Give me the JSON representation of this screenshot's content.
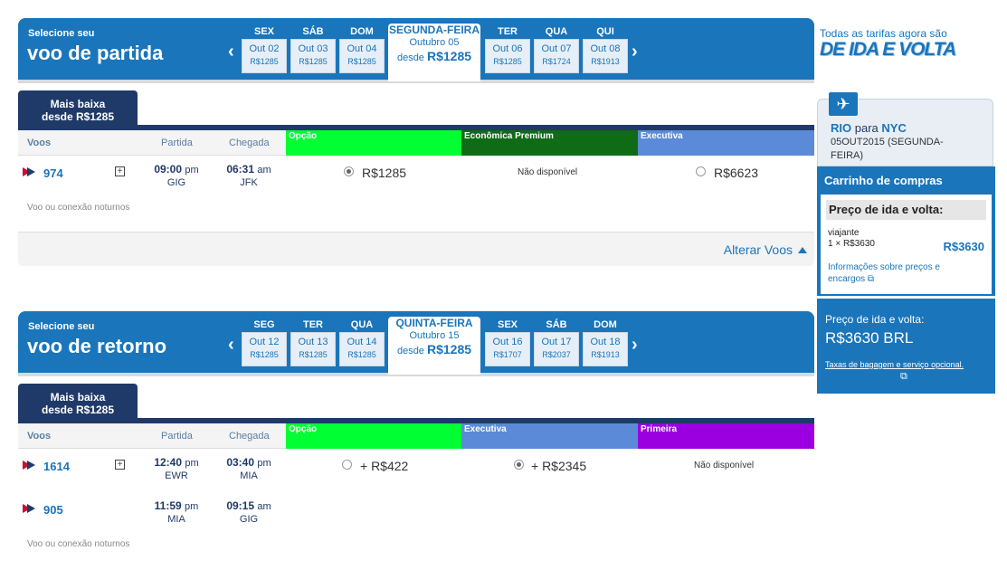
{
  "outbound": {
    "select_small": "Selecione seu",
    "select_big": "voo de partida",
    "days": [
      {
        "name": "SEX",
        "date": "Out 02",
        "price": "R$1285"
      },
      {
        "name": "SÁB",
        "date": "Out 03",
        "price": "R$1285"
      },
      {
        "name": "DOM",
        "date": "Out 04",
        "price": "R$1285"
      },
      {
        "name": "TER",
        "date": "Out 06",
        "price": "R$1285"
      },
      {
        "name": "QUA",
        "date": "Out 07",
        "price": "R$1724"
      },
      {
        "name": "QUI",
        "date": "Out 08",
        "price": "R$1913"
      }
    ],
    "selected": {
      "name": "SEGUNDA-FEIRA",
      "month": "Outubro 05",
      "from": "desde",
      "price": "R$1285"
    },
    "tab": {
      "line1": "Mais baixa",
      "line2": "desde R$1285"
    },
    "headers": {
      "voos": "Voos",
      "partida": "Partida",
      "chegada": "Chegada",
      "fare1": "Opção",
      "fare2": "Econômica Premium",
      "fare3": "Executiva"
    },
    "rows": [
      {
        "flight": "974",
        "dep_time": "09:00",
        "dep_ampm": "pm",
        "dep_airport": "GIG",
        "arr_time": "06:31",
        "arr_ampm": "am",
        "arr_airport": "JFK",
        "fare1": "R$1285",
        "fare2": "Não disponível",
        "fare3": "R$6623"
      }
    ],
    "night_note": "Voo ou conexão noturnos",
    "change_label": "Alterar Voos"
  },
  "return": {
    "select_small": "Selecione seu",
    "select_big": "voo de retorno",
    "days": [
      {
        "name": "SEG",
        "date": "Out 12",
        "price": "R$1285"
      },
      {
        "name": "TER",
        "date": "Out 13",
        "price": "R$1285"
      },
      {
        "name": "QUA",
        "date": "Out 14",
        "price": "R$1285"
      },
      {
        "name": "SEX",
        "date": "Out 16",
        "price": "R$1707"
      },
      {
        "name": "SÁB",
        "date": "Out 17",
        "price": "R$2037"
      },
      {
        "name": "DOM",
        "date": "Out 18",
        "price": "R$1913"
      }
    ],
    "selected": {
      "name": "QUINTA-FEIRA",
      "month": "Outubro 15",
      "from": "desde",
      "price": "R$1285"
    },
    "tab": {
      "line1": "Mais baixa",
      "line2": "desde R$1285"
    },
    "headers": {
      "voos": "Voos",
      "partida": "Partida",
      "chegada": "Chegada",
      "fare1": "Opção",
      "fare2": "Executiva",
      "fare3": "Primeira"
    },
    "rows": [
      {
        "flight": "1614",
        "dep_time": "12:40",
        "dep_ampm": "pm",
        "dep_airport": "EWR",
        "arr_time": "03:40",
        "arr_ampm": "pm",
        "arr_airport": "MIA",
        "fare1": "+ R$422",
        "fare2": "+ R$2345",
        "fare3": "Não disponível"
      },
      {
        "flight": "905",
        "dep_time": "11:59",
        "dep_ampm": "pm",
        "dep_airport": "MIA",
        "arr_time": "09:15",
        "arr_ampm": "am",
        "arr_airport": "GIG"
      }
    ],
    "night_note": "Voo ou conexão noturnos"
  },
  "sidebar": {
    "promo_small": "Todas as tarifas agora são",
    "promo_big": "DE IDA E VOLTA",
    "route_from": "RIO",
    "route_para": "para",
    "route_to": "NYC",
    "route_date": "05OUT2015 (SEGUNDA-FEIRA)",
    "cart_title": "Carrinho de compras",
    "cart_price_header": "Preço de ida e volta:",
    "traveler": "viajante",
    "traveler_detail": "1 × R$3630",
    "traveler_price": "R$3630",
    "info_link": "Informações sobre preços e encargos",
    "total_label": "Preço de ida e volta:",
    "total_value": "R$3630 BRL",
    "taxes_link": "Taxas de bagagem e serviço opcional."
  },
  "colors": {
    "brand_blue": "#1a75bb",
    "navy": "#1f3a68",
    "opcao_green": "#00ff33",
    "premium_green": "#0f6b16",
    "executiva_blue": "#5b8bd8",
    "primeira_purple": "#9b00e0"
  }
}
